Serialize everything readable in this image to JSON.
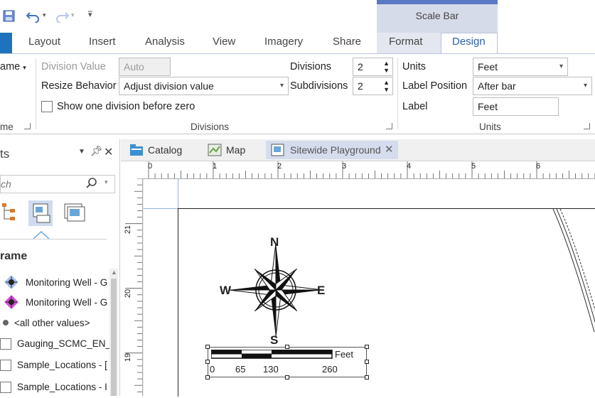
{
  "quick_access": {
    "save_icon": "save-icon",
    "undo_icon": "undo-icon",
    "redo_icon": "redo-icon",
    "customize_icon": "customize-icon"
  },
  "contextual": {
    "label": "Scale Bar"
  },
  "tabs": [
    "Layout",
    "Insert",
    "Analysis",
    "View",
    "Imagery",
    "Share",
    "Format",
    "Design"
  ],
  "ribbon": {
    "frame_label": "ame",
    "division_value_label": "Division Value",
    "division_value": "Auto",
    "resize_behavior_label": "Resize Behavior",
    "resize_behavior_value": "Adjust division value",
    "show_one_division_label": "Show one division before zero",
    "divisions_label": "Divisions",
    "divisions_value": "2",
    "subdivisions_label": "Subdivisions",
    "subdivisions_value": "2",
    "units_label": "Units",
    "units_value": "Feet",
    "label_position_label": "Label Position",
    "label_position_value": "After bar",
    "label_label": "Label",
    "label_value": "Feet",
    "group_left": "me",
    "group_divisions": "Divisions",
    "group_units": "Units"
  },
  "pane": {
    "title": "ts",
    "search_placeholder": "ch",
    "section": "rame",
    "items": [
      "Monitoring Well - G",
      "Monitoring Well - G",
      "<all other values>",
      "Gauging_SCMC_EN_",
      "Sample_Locations - [",
      "Sample_Locations - I"
    ]
  },
  "doc_tabs": [
    "Catalog",
    "Map",
    "Sitewide Playground"
  ],
  "ruler": {
    "h_labels": [
      "0",
      "1",
      "2",
      "3",
      "4",
      "5",
      "6"
    ],
    "v_labels": [
      "21",
      "20",
      "19"
    ]
  },
  "compass": {
    "n": "N",
    "s": "S",
    "e": "E",
    "w": "W"
  },
  "scalebar": {
    "unit": "Feet",
    "labels": [
      "0",
      "65",
      "130",
      "260"
    ]
  },
  "colors": {
    "accent": "#2b5fad",
    "contextual_band": "#d6dbe9",
    "contextual_stripe": "#5b78c4",
    "file_tab": "#1e73be"
  }
}
